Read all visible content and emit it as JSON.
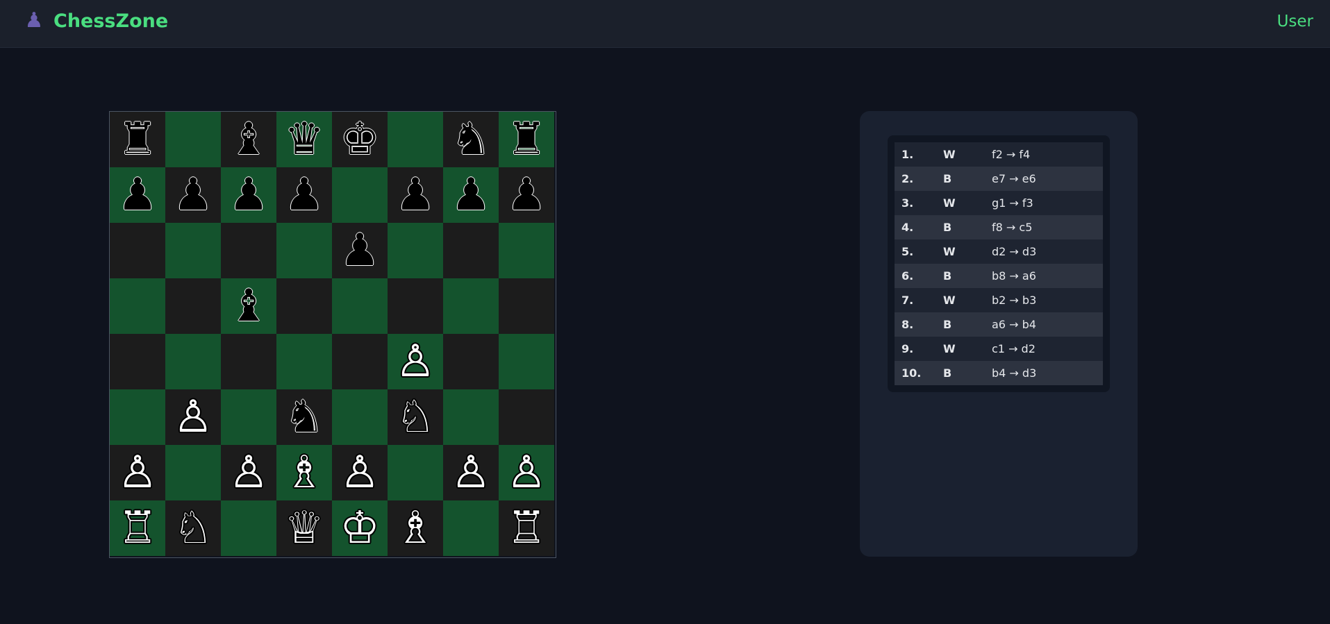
{
  "header": {
    "logo_icon": "chess-pawn-icon",
    "logo_glyph": "♟",
    "brand": "ChessZone",
    "user_label": "User"
  },
  "colors": {
    "accent": "#4ade80",
    "dark_square": "#14532d",
    "light_square": "#1c1c1c",
    "background": "#0f131e"
  },
  "board": {
    "rows": [
      [
        "♜",
        "",
        "♝",
        "♛",
        "♚",
        "",
        "♞",
        "♜"
      ],
      [
        "♟",
        "♟",
        "♟",
        "♟",
        "",
        "♟",
        "♟",
        "♟"
      ],
      [
        "",
        "",
        "",
        "",
        "♟",
        "",
        "",
        ""
      ],
      [
        "",
        "",
        "♝",
        "",
        "",
        "",
        "",
        ""
      ],
      [
        "",
        "",
        "",
        "",
        "",
        "♙",
        "",
        ""
      ],
      [
        "",
        "♙",
        "",
        "♞",
        "",
        "♘",
        "",
        ""
      ],
      [
        "♙",
        "",
        "♙",
        "♗",
        "♙",
        "",
        "♙",
        "♙"
      ],
      [
        "♖",
        "♘",
        "",
        "♕",
        "♔",
        "♗",
        "",
        "♖"
      ]
    ]
  },
  "moves": [
    {
      "num": "1.",
      "side": "W",
      "move": "f2 → f4"
    },
    {
      "num": "2.",
      "side": "B",
      "move": "e7 → e6"
    },
    {
      "num": "3.",
      "side": "W",
      "move": "g1 → f3"
    },
    {
      "num": "4.",
      "side": "B",
      "move": "f8 → c5"
    },
    {
      "num": "5.",
      "side": "W",
      "move": "d2 → d3"
    },
    {
      "num": "6.",
      "side": "B",
      "move": "b8 → a6"
    },
    {
      "num": "7.",
      "side": "W",
      "move": "b2 → b3"
    },
    {
      "num": "8.",
      "side": "B",
      "move": "a6 → b4"
    },
    {
      "num": "9.",
      "side": "W",
      "move": "c1 → d2"
    },
    {
      "num": "10.",
      "side": "B",
      "move": "b4 → d3"
    }
  ]
}
